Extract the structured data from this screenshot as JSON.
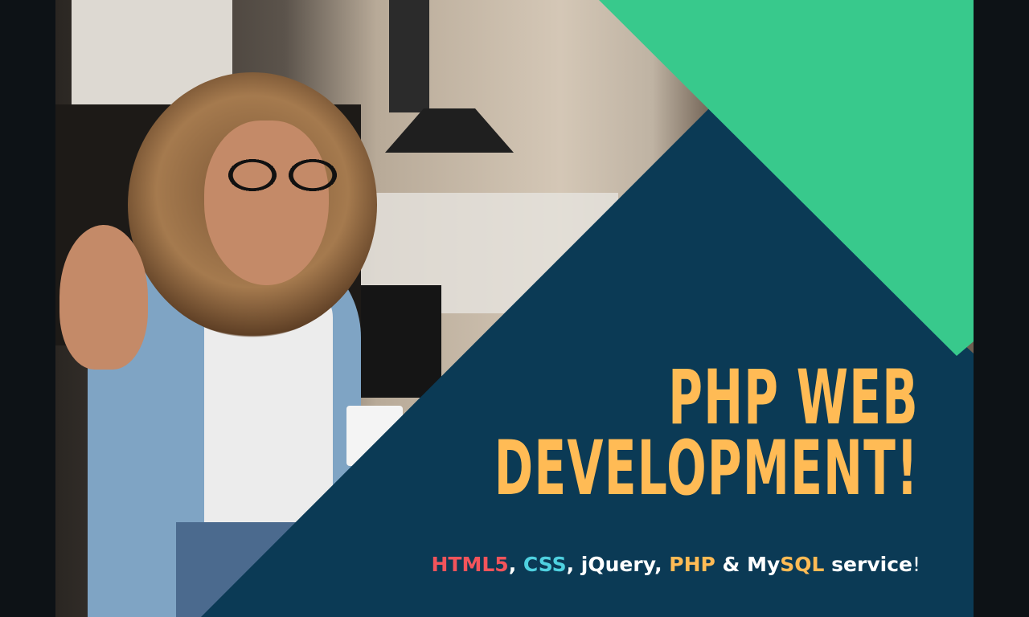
{
  "banner": {
    "title_line1": "PHP WEB",
    "title_line2": "DEVELOPMENT!",
    "subtitle": {
      "html5": "HTML5",
      "sep1": ", ",
      "css": "CSS",
      "sep2": ", ",
      "jquery": "jQuery",
      "sep3": ", ",
      "php": "PHP",
      "amp": " & ",
      "my": "My",
      "sql": "SQL",
      "service": " service",
      "excl": "!"
    }
  },
  "colors": {
    "background": "#0d1216",
    "navy": "#0b3a55",
    "green": "#38c98c",
    "title": "#ffbb55",
    "html5": "#f2545b",
    "css": "#4fd1e0",
    "php_sql": "#ffbb55"
  }
}
